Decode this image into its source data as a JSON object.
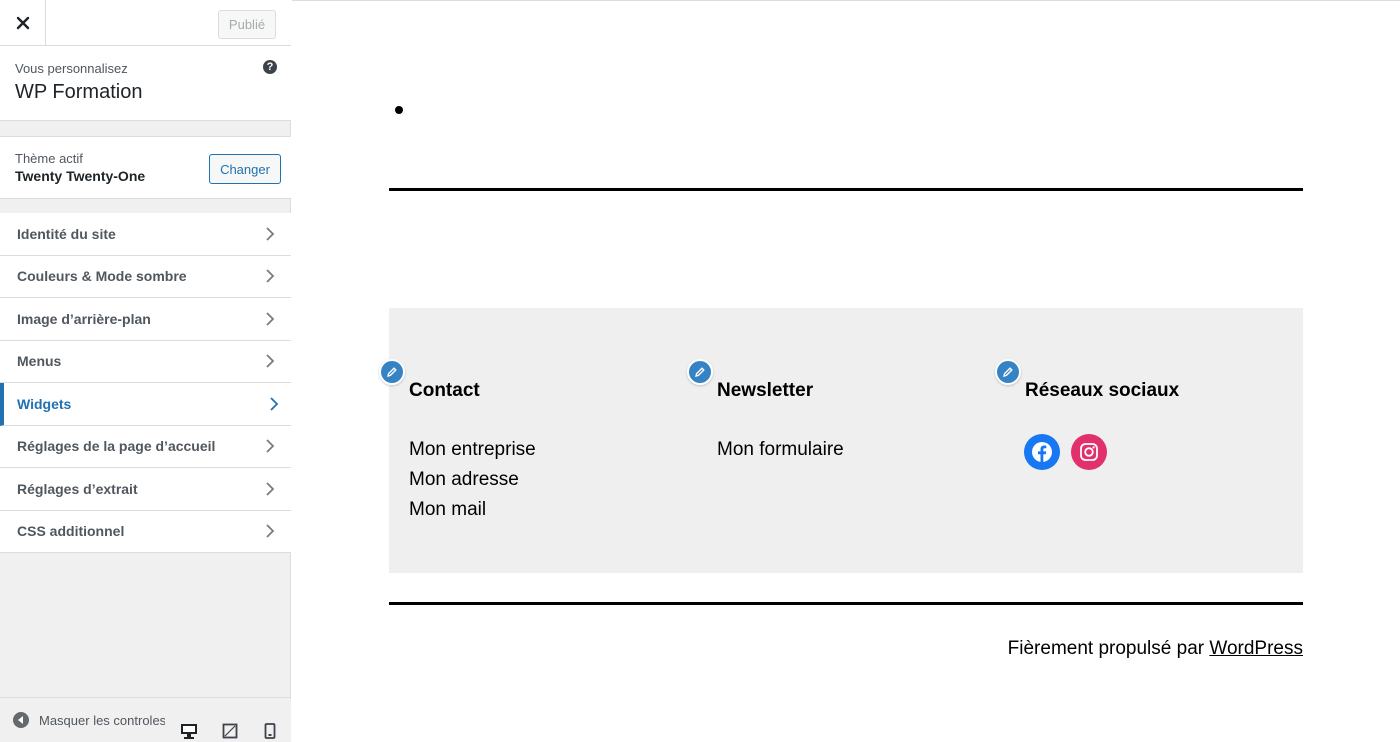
{
  "customizer": {
    "publish_label": "Publié",
    "info_prefix": "Vous personnalisez",
    "site_title": "WP Formation",
    "theme_prefix": "Thème actif",
    "theme_name": "Twenty Twenty-One",
    "change_label": "Changer",
    "menu_items": [
      {
        "label": "Identité du site"
      },
      {
        "label": "Couleurs & Mode sombre"
      },
      {
        "label": "Image d’arrière-plan"
      },
      {
        "label": "Menus"
      },
      {
        "label": "Widgets"
      },
      {
        "label": "Réglages de la page d’accueil"
      },
      {
        "label": "Réglages d’extrait"
      },
      {
        "label": "CSS additionnel"
      }
    ],
    "active_item": "Widgets",
    "collapse_label": "Masquer les controles",
    "accent_color": "#2271b1"
  },
  "preview": {
    "widgets": [
      {
        "title": "Contact",
        "lines": [
          "Mon entreprise",
          "Mon adresse",
          "Mon mail"
        ]
      },
      {
        "title": "Newsletter",
        "lines": [
          "Mon formulaire"
        ]
      },
      {
        "title": "Réseaux sociaux",
        "icons": [
          "facebook-icon",
          "instagram-icon"
        ]
      }
    ],
    "credits_prefix": "Fièrement propulsé par",
    "credits_link": "WordPress",
    "widget_bg": "#efefef",
    "facebook_color": "#1877f2",
    "instagram_color": "#e1306c"
  }
}
